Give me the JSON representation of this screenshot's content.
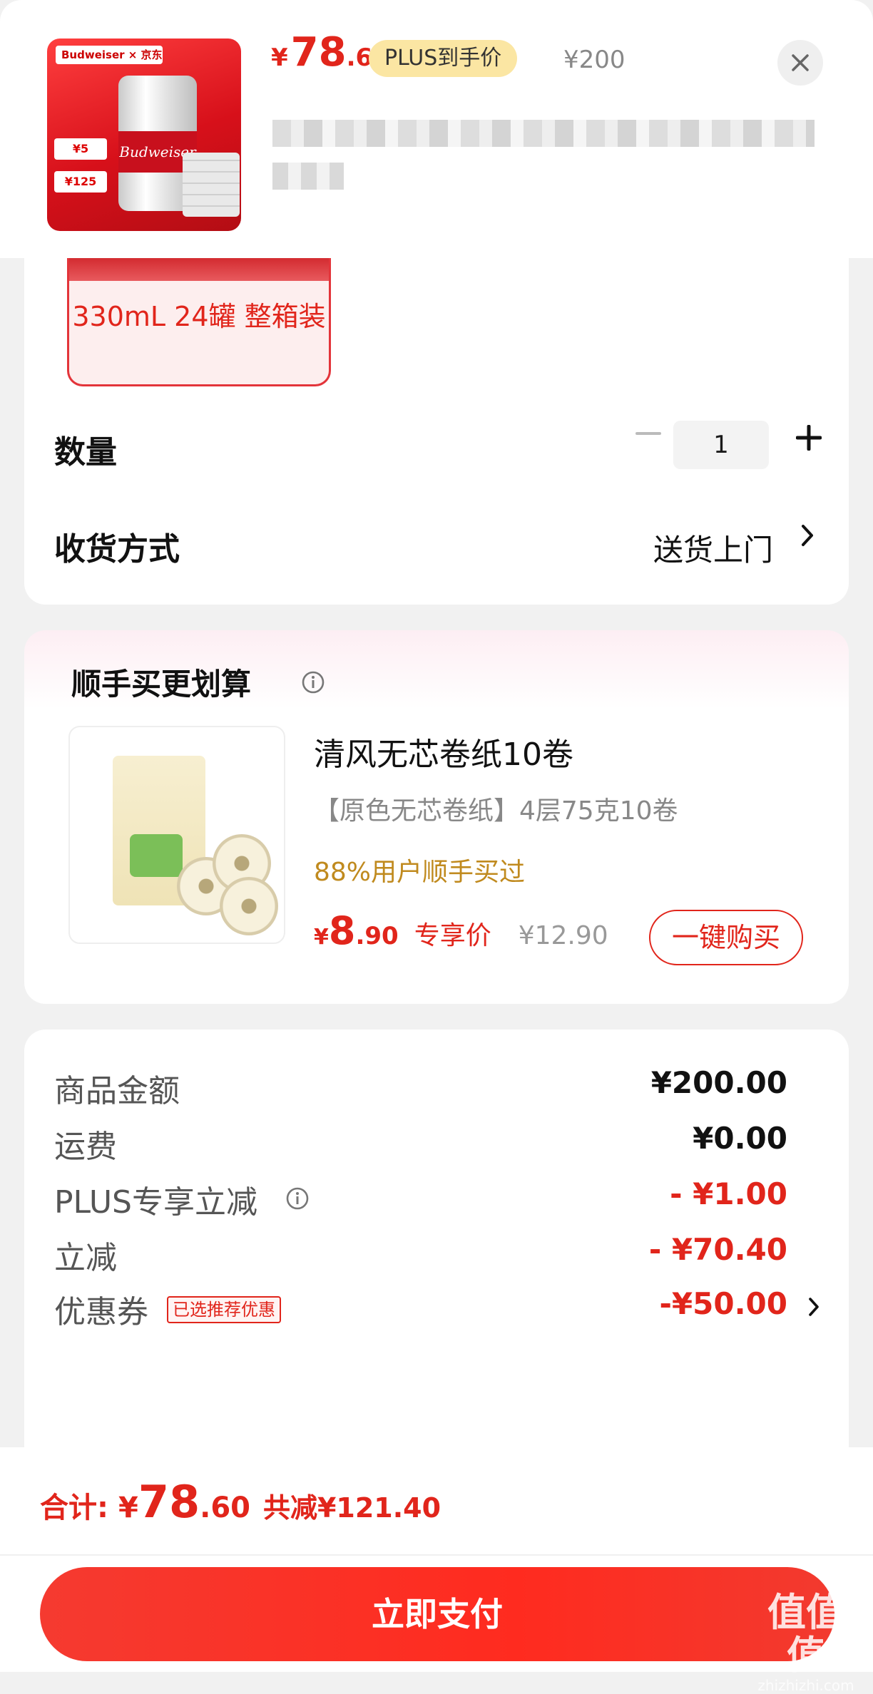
{
  "header": {
    "currency": "¥",
    "price_int": "78",
    "price_dec": ".6",
    "plus_badge": "PLUS到手价",
    "original_price": "¥200",
    "thumb_brand": "Budweiser × 京东",
    "thumb_can_label": "Budweiser",
    "thumb_tag_1": "¥5",
    "thumb_tag_2": "¥125"
  },
  "spec": {
    "selected_label": "330mL 24罐 整箱装"
  },
  "quantity": {
    "label": "数量",
    "value": "1"
  },
  "delivery": {
    "label": "收货方式",
    "value": "送货上门"
  },
  "upsell": {
    "title": "顺手买更划算",
    "name": "清风无芯卷纸10卷",
    "desc": "【原色无芯卷纸】4层75克10卷",
    "stat": "88%用户顺手买过",
    "currency": "¥",
    "price_int": "8",
    "price_dec": ".90",
    "price_tag": "专享价",
    "orig_price": "¥12.90",
    "buy_label": "一键购买"
  },
  "summary": {
    "rows": [
      {
        "label": "商品金额",
        "value": "¥200.00"
      },
      {
        "label": "运费",
        "value": "¥0.00"
      },
      {
        "label": "PLUS专享立减",
        "value": "- ¥1.00"
      },
      {
        "label": "立减",
        "value": "- ¥70.40"
      },
      {
        "label": "优惠券",
        "value": "-¥50.00",
        "tag": "已选推荐优惠"
      }
    ]
  },
  "footer": {
    "total_label": "合计:",
    "currency": "¥",
    "total_int": "78",
    "total_dec": ".60",
    "total_saved": "共减¥121.40",
    "pay_label": "立即支付"
  },
  "watermark": {
    "text": "值值值",
    "url": "zhizhizhi.com"
  },
  "colors": {
    "accent_red": "#e1251b",
    "plus_badge_bg": "#fbe6a3",
    "stat_gold": "#c08a1e"
  },
  "icons": [
    "close-icon",
    "minus-icon",
    "plus-icon",
    "chevron-right-icon",
    "info-icon"
  ]
}
